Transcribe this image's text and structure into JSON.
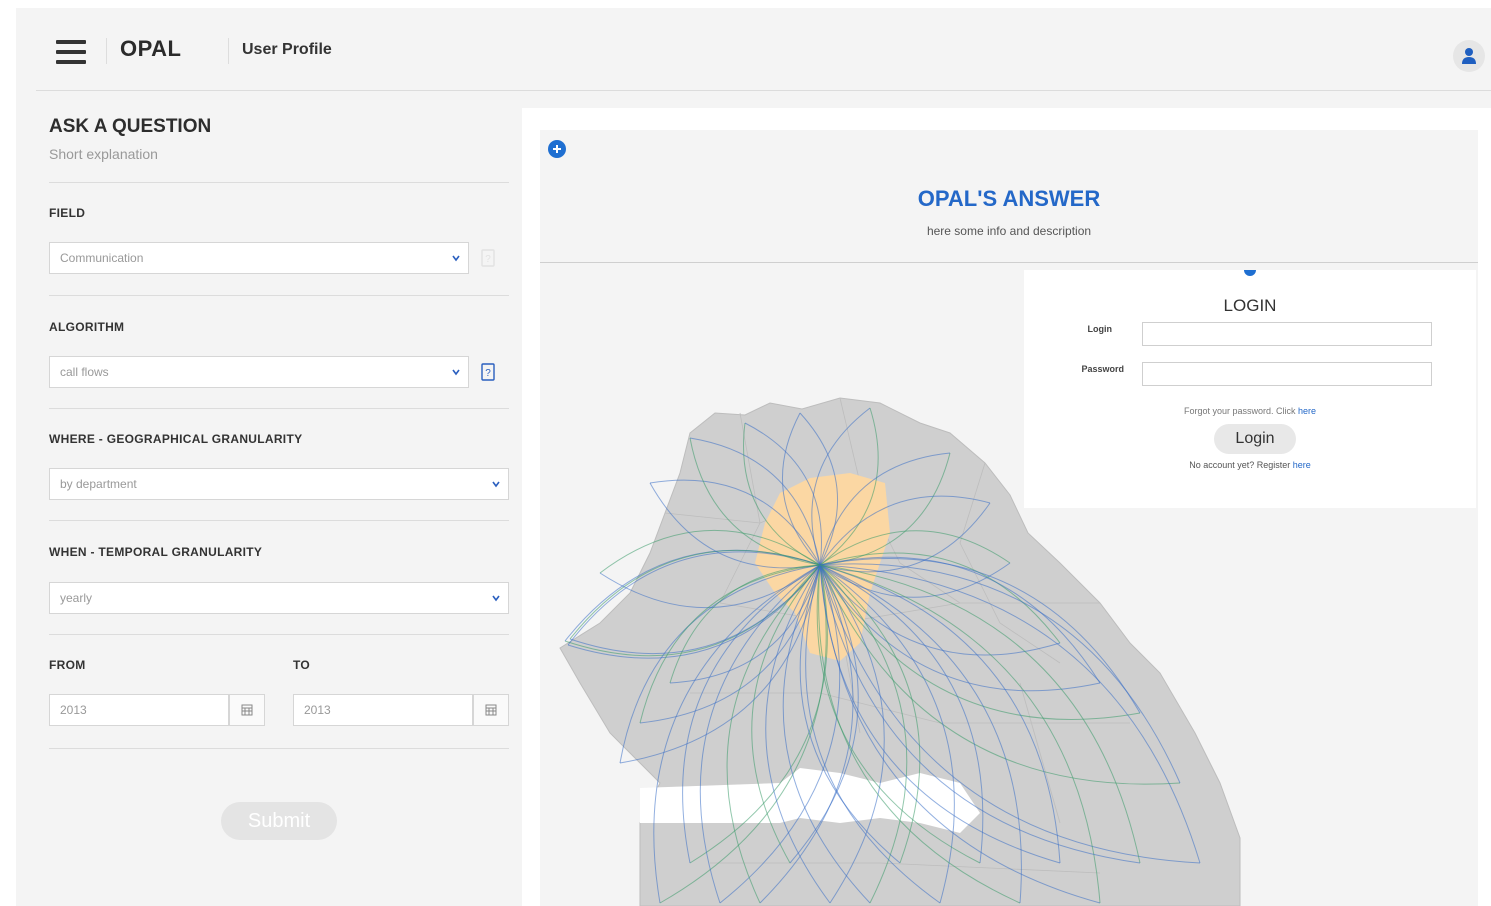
{
  "header": {
    "brand": "OPAL",
    "nav_item": "User Profile"
  },
  "question_panel": {
    "title": "ASK A QUESTION",
    "subtitle": "Short explanation",
    "field": {
      "label": "FIELD",
      "value": "Communication"
    },
    "algorithm": {
      "label": "ALGORITHM",
      "value": "call flows"
    },
    "where": {
      "label": "WHERE - GEOGRAPHICAL GRANULARITY",
      "value": "by department"
    },
    "when": {
      "label": "WHEN - TEMPORAL GRANULARITY",
      "value": "yearly"
    },
    "from": {
      "label": "FROM",
      "value": "2013"
    },
    "to": {
      "label": "TO",
      "value": "2013"
    },
    "submit_label": "Submit"
  },
  "answer_panel": {
    "title": "OPAL'S ANSWER",
    "subtitle": "here some info and description"
  },
  "login": {
    "title": "LOGIN",
    "login_label": "Login",
    "password_label": "Password",
    "forgot_text": "Forgot your password. Click ",
    "forgot_link": "here",
    "button_label": "Login",
    "no_account_text": "No account yet? Register ",
    "no_account_link": "here"
  },
  "colors": {
    "accent": "#2468c8",
    "map_land": "#cfcfcf",
    "highlight_region": "#fbd7a3",
    "flow_blue": "#3b6fc7",
    "flow_green": "#3a9a6a"
  }
}
